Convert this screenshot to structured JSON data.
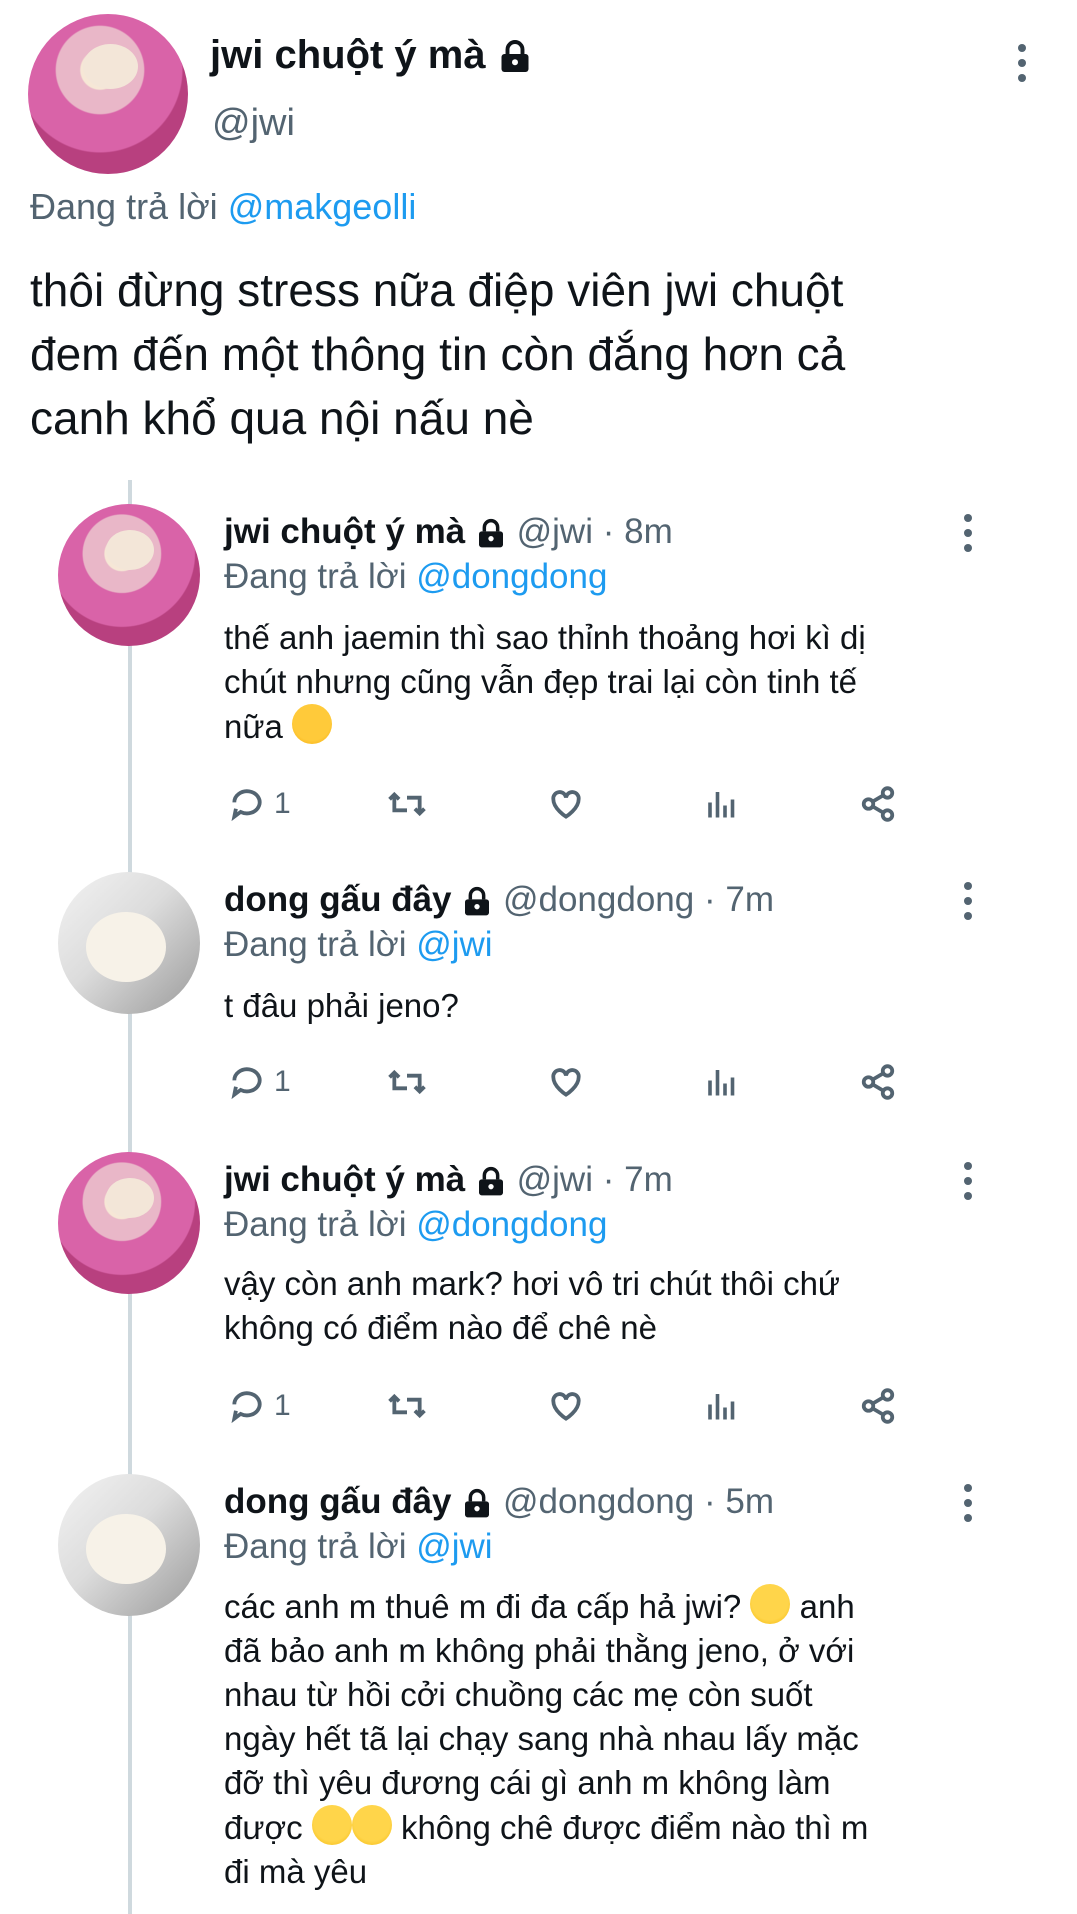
{
  "main": {
    "name": "jwi chuột ý mà",
    "handle": "@jwi",
    "replying_prefix": "Đang trả lời",
    "replying_to": "@makgeolli",
    "text_lines": [
      "thôi đừng stress nữa điệp viên jwi chuột",
      "đem đến một thông tin còn đắng hơn cả",
      "canh khổ qua nội nấu nè"
    ]
  },
  "replies": [
    {
      "name": "jwi chuột ý mà",
      "handle": "@jwi",
      "sep": "·",
      "time": "8m",
      "replying_prefix": "Đang trả lời",
      "replying_to": "@dongdong",
      "lines": [
        "thế anh jaemin thì sao thỉnh thoảng hơi kì dị",
        "chút nhưng cũng vẫn đẹp trai lại còn tinh tế",
        "nữa"
      ],
      "reply_count": "1"
    },
    {
      "name": "dong gấu đây",
      "handle": "@dongdong",
      "sep": "·",
      "time": "7m",
      "replying_prefix": "Đang trả lời",
      "replying_to": "@jwi",
      "lines": [
        "t đâu phải jeno?"
      ],
      "reply_count": "1"
    },
    {
      "name": "jwi chuột ý mà",
      "handle": "@jwi",
      "sep": "·",
      "time": "7m",
      "replying_prefix": "Đang trả lời",
      "replying_to": "@dongdong",
      "lines": [
        "vậy còn anh mark? hơi vô tri chút thôi chứ",
        "không có điểm nào để chê nè"
      ],
      "reply_count": "1"
    },
    {
      "name": "dong gấu đây",
      "handle": "@dongdong",
      "sep": "·",
      "time": "5m",
      "replying_prefix": "Đang trả lời",
      "replying_to": "@jwi",
      "lines": [
        "các anh m thuê m đi đa cấp hả jwi?",
        "anh",
        "đã bảo anh m không phải thằng jeno, ở với",
        "nhau từ hồi cởi chuồng các mẹ còn suốt",
        "ngày hết tã lại chạy sang nhà nhau lấy mặc",
        "đỡ thì yêu đương cái gì anh m không làm",
        "được",
        "không chê được điểm nào thì m",
        "đi mà yêu"
      ]
    }
  ],
  "icons": {
    "lock": "lock-icon",
    "more": "more-vertical-icon",
    "reply": "reply-icon",
    "retweet": "retweet-icon",
    "like": "heart-icon",
    "views": "views-icon",
    "share": "share-icon"
  },
  "colors": {
    "link": "#1d9bf0",
    "muted": "#536471",
    "thread_line": "#cfd9de"
  }
}
